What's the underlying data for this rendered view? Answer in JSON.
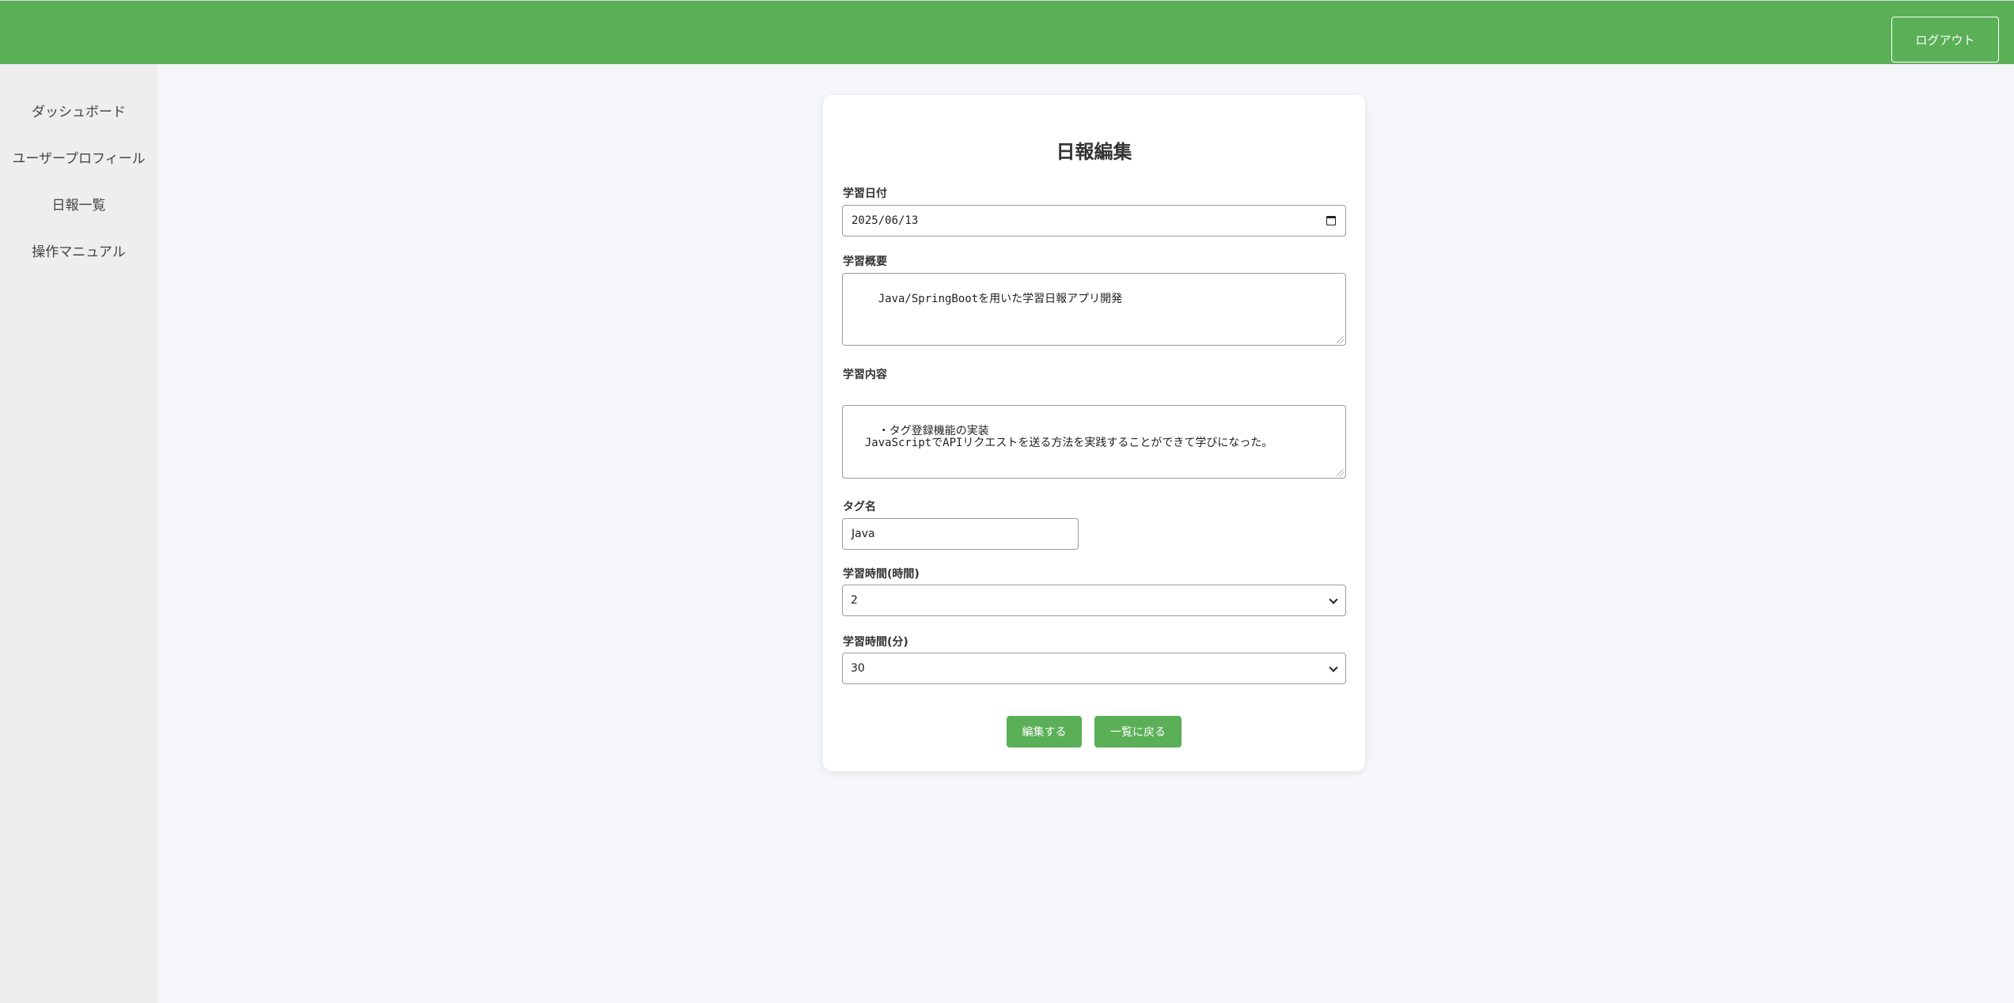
{
  "header": {
    "logout_label": "ログアウト"
  },
  "sidebar": {
    "items": [
      {
        "label": "ダッシュボード"
      },
      {
        "label": "ユーザープロフィール"
      },
      {
        "label": "日報一覧"
      },
      {
        "label": "操作マニュアル"
      }
    ]
  },
  "form": {
    "title": "日報編集",
    "date": {
      "label": "学習日付",
      "value": "2025/06/13"
    },
    "summary": {
      "label": "学習概要",
      "value": "Java/SpringBootを用いた学習日報アプリ開発"
    },
    "content": {
      "label": "学習内容",
      "value": "・タグ登録機能の実装\n  JavaScriptでAPIリクエストを送る方法を実践することができて学びになった。"
    },
    "tag": {
      "label": "タグ名",
      "value": "Java"
    },
    "hours": {
      "label": "学習時間(時間)",
      "value": "2"
    },
    "minutes": {
      "label": "学習時間(分)",
      "value": "30"
    },
    "submit_label": "編集する",
    "back_label": "一覧に戻る"
  },
  "colors": {
    "accent": "#5aaf57",
    "sidebar_bg": "#eeeeee",
    "page_bg": "#f4f6f9"
  }
}
